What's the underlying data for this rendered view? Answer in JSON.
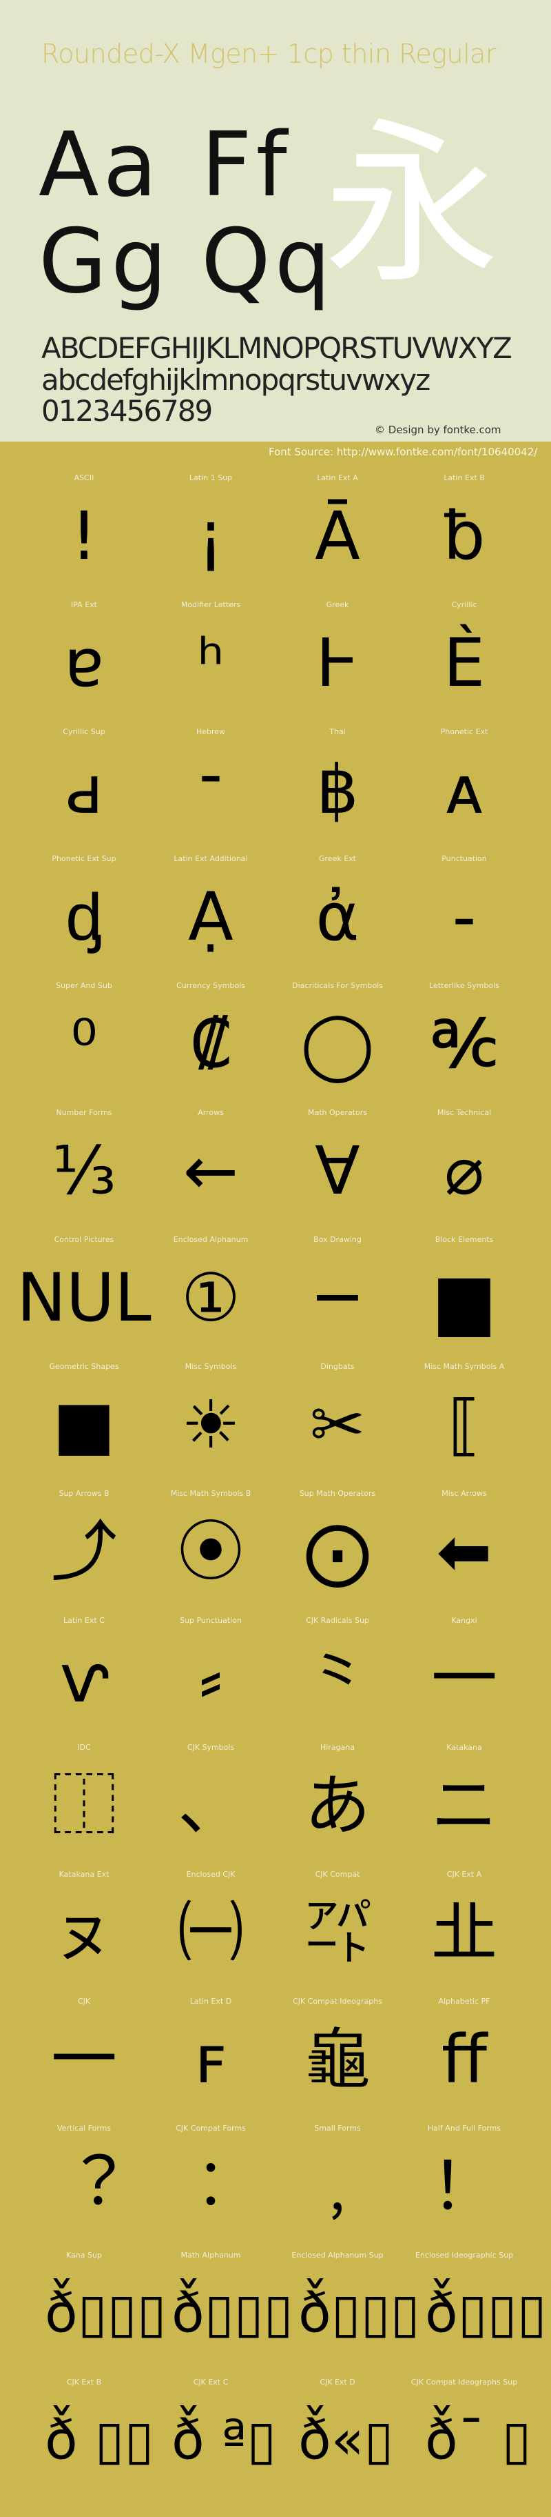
{
  "header": {
    "title": "Rounded-X Mgen+ 1cp thin Regular",
    "sample_pairs": [
      "Aa",
      "Ff",
      "Gg",
      "Qq"
    ],
    "sample_kanji": "永",
    "uppercase": "ABCDEFGHIJKLMNOPQRSTUVWXYZ",
    "lowercase": "abcdefghijklmnopqrstuvwxyz",
    "digits": "0123456789",
    "copyright": "© Design by fontke.com",
    "font_source": "Font Source: http://www.fontke.com/font/10640042/"
  },
  "colors": {
    "header_bg": "#e4e6cb",
    "body_bg": "#cab74f",
    "title": "#d4c26c",
    "kanji": "#ffffff",
    "label": "#f3efd6"
  },
  "blocks": [
    {
      "label": "ASCII",
      "glyph": "!"
    },
    {
      "label": "Latin 1 Sup",
      "glyph": "¡"
    },
    {
      "label": "Latin Ext A",
      "glyph": "Ā"
    },
    {
      "label": "Latin Ext B",
      "glyph": "ƀ"
    },
    {
      "label": "IPA Ext",
      "glyph": "ɐ"
    },
    {
      "label": "Modifier Letters",
      "glyph": "ʰ"
    },
    {
      "label": "Greek",
      "glyph": "Ͱ"
    },
    {
      "label": "Cyrillic",
      "glyph": "Ѐ"
    },
    {
      "label": "Cyrillic Sup",
      "glyph": "ԁ"
    },
    {
      "label": "Hebrew",
      "glyph": "־"
    },
    {
      "label": "Thai",
      "glyph": "฿"
    },
    {
      "label": "Phonetic Ext",
      "glyph": "ᴀ"
    },
    {
      "label": "Phonetic Ext Sup",
      "glyph": "ᶁ"
    },
    {
      "label": "Latin Ext Additional",
      "glyph": "Ạ"
    },
    {
      "label": "Greek Ext",
      "glyph": "ἀ"
    },
    {
      "label": "Punctuation",
      "glyph": "‐"
    },
    {
      "label": "Super And Sub",
      "glyph": "⁰"
    },
    {
      "label": "Currency Symbols",
      "glyph": "₡"
    },
    {
      "label": "Diacriticals For Symbols",
      "glyph": "◯"
    },
    {
      "label": "Letterlike Symbols",
      "glyph": "℀"
    },
    {
      "label": "Number Forms",
      "glyph": "⅓"
    },
    {
      "label": "Arrows",
      "glyph": "←"
    },
    {
      "label": "Math Operators",
      "glyph": "∀"
    },
    {
      "label": "Misc Technical",
      "glyph": "⌀"
    },
    {
      "label": "Control Pictures",
      "glyph": "NUL"
    },
    {
      "label": "Enclosed Alphanum",
      "glyph": "①"
    },
    {
      "label": "Box Drawing",
      "glyph": "─"
    },
    {
      "label": "Block Elements",
      "glyph": "▆"
    },
    {
      "label": "Geometric Shapes",
      "glyph": "■"
    },
    {
      "label": "Misc Symbols",
      "glyph": "☀"
    },
    {
      "label": "Dingbats",
      "glyph": "✂"
    },
    {
      "label": "Misc Math Symbols A",
      "glyph": "⟦"
    },
    {
      "label": "Sup Arrows B",
      "glyph": "⤴"
    },
    {
      "label": "Misc Math Symbols B",
      "glyph": "⦿"
    },
    {
      "label": "Sup Math Operators",
      "glyph": "⨀"
    },
    {
      "label": "Misc Arrows",
      "glyph": "⬅"
    },
    {
      "label": "Latin Ext C",
      "glyph": "ⱱ"
    },
    {
      "label": "Sup Punctuation",
      "glyph": "⸗"
    },
    {
      "label": "CJK Radicals Sup",
      "glyph": "⺀"
    },
    {
      "label": "Kangxi",
      "glyph": "⼀"
    },
    {
      "label": "IDC",
      "glyph": "⿰"
    },
    {
      "label": "CJK Symbols",
      "glyph": "、"
    },
    {
      "label": "Hiragana",
      "glyph": "あ"
    },
    {
      "label": "Katakana",
      "glyph": "ニ"
    },
    {
      "label": "Katakana Ext",
      "glyph": "ㇴ"
    },
    {
      "label": "Enclosed CJK",
      "glyph": "㈠"
    },
    {
      "label": "CJK Compat",
      "glyph": "㌀"
    },
    {
      "label": "CJK Ext A",
      "glyph": "㐀"
    },
    {
      "label": "CJK",
      "glyph": "一"
    },
    {
      "label": "Latin Ext D",
      "glyph": "ꜰ"
    },
    {
      "label": "CJK Compat Ideographs",
      "glyph": "龜"
    },
    {
      "label": "Alphabetic PF",
      "glyph": "ﬀ"
    },
    {
      "label": "Vertical Forms",
      "glyph": "︖"
    },
    {
      "label": "CJK Compat Forms",
      "glyph": "︰"
    },
    {
      "label": "Small Forms",
      "glyph": "﹐"
    },
    {
      "label": "Half And Full Forms",
      "glyph": "！"
    },
    {
      "label": "Kana Sup",
      "glyph": "ð̌▯▯▯"
    },
    {
      "label": "Math Alphanum",
      "glyph": "ð̌▯▯▯"
    },
    {
      "label": "Enclosed Alphanum Sup",
      "glyph": "ð̌▯▯▯"
    },
    {
      "label": "Enclosed Ideographic Sup",
      "glyph": "ð̌▯▯▯"
    },
    {
      "label": "CJK Ext B",
      "glyph": "ð̌ ▯▯"
    },
    {
      "label": "CJK Ext C",
      "glyph": "ð̌ ª▯"
    },
    {
      "label": "CJK Ext D",
      "glyph": "ð̌«▯"
    },
    {
      "label": "CJK Compat Ideographs Sup",
      "glyph": "ð̌¯ ▯"
    }
  ]
}
